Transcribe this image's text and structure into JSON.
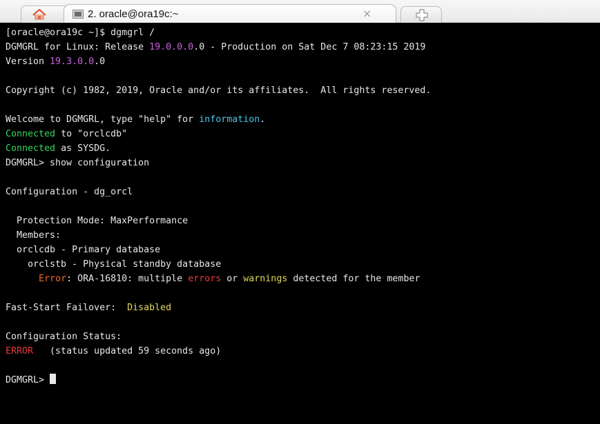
{
  "colors": {
    "default": "#e8e8e8",
    "purple": "#c862dc",
    "green": "#34d65a",
    "cyan": "#4cc6e8",
    "red": "#e63a3a",
    "orange": "#ef6a2c",
    "yellow": "#e2d95a",
    "background": "#000000"
  },
  "tabbar": {
    "home_icon": "home-icon",
    "active_tab": {
      "icon": "terminal-icon",
      "title": "2. oracle@ora19c:~",
      "close_glyph": "×"
    },
    "new_tab_icon": "new-tab-icon"
  },
  "terminal": {
    "lines": [
      [
        {
          "t": "[oracle@ora19c ~]$ dgmgrl /",
          "c": "default"
        }
      ],
      [
        {
          "t": "DGMGRL for Linux: Release ",
          "c": "default"
        },
        {
          "t": "19.0.0.0",
          "c": "purple"
        },
        {
          "t": ".0 - Production on Sat Dec 7 08:23:15 2019",
          "c": "default"
        }
      ],
      [
        {
          "t": "Version ",
          "c": "default"
        },
        {
          "t": "19.3.0.0",
          "c": "purple"
        },
        {
          "t": ".0",
          "c": "default"
        }
      ],
      [],
      [
        {
          "t": "Copyright (c) 1982, 2019, Oracle and/or its affiliates.  All rights reserved.",
          "c": "default"
        }
      ],
      [],
      [
        {
          "t": "Welcome to DGMGRL, type \"help\" for ",
          "c": "default"
        },
        {
          "t": "information",
          "c": "cyan"
        },
        {
          "t": ".",
          "c": "default"
        }
      ],
      [
        {
          "t": "Connected",
          "c": "green"
        },
        {
          "t": " to \"orclcdb\"",
          "c": "default"
        }
      ],
      [
        {
          "t": "Connected",
          "c": "green"
        },
        {
          "t": " as SYSDG.",
          "c": "default"
        }
      ],
      [
        {
          "t": "DGMGRL> show configuration",
          "c": "default"
        }
      ],
      [],
      [
        {
          "t": "Configuration - dg_orcl",
          "c": "default"
        }
      ],
      [],
      [
        {
          "t": "  Protection Mode: MaxPerformance",
          "c": "default"
        }
      ],
      [
        {
          "t": "  Members:",
          "c": "default"
        }
      ],
      [
        {
          "t": "  orclcdb - Primary database",
          "c": "default"
        }
      ],
      [
        {
          "t": "    orclstb - Physical standby database",
          "c": "default"
        }
      ],
      [
        {
          "t": "      ",
          "c": "default"
        },
        {
          "t": "Error",
          "c": "orange"
        },
        {
          "t": ": ORA-16810: multiple ",
          "c": "default"
        },
        {
          "t": "errors",
          "c": "red"
        },
        {
          "t": " or ",
          "c": "default"
        },
        {
          "t": "warnings",
          "c": "yellow"
        },
        {
          "t": " detected for the member",
          "c": "default"
        }
      ],
      [],
      [
        {
          "t": "Fast-Start Failover:  ",
          "c": "default"
        },
        {
          "t": "Disabled",
          "c": "yellow"
        }
      ],
      [],
      [
        {
          "t": "Configuration Status:",
          "c": "default"
        }
      ],
      [
        {
          "t": "ERROR",
          "c": "red"
        },
        {
          "t": "   (status updated 59 seconds ago)",
          "c": "default"
        }
      ],
      [],
      [
        {
          "t": "DGMGRL> ",
          "c": "default"
        }
      ]
    ]
  }
}
